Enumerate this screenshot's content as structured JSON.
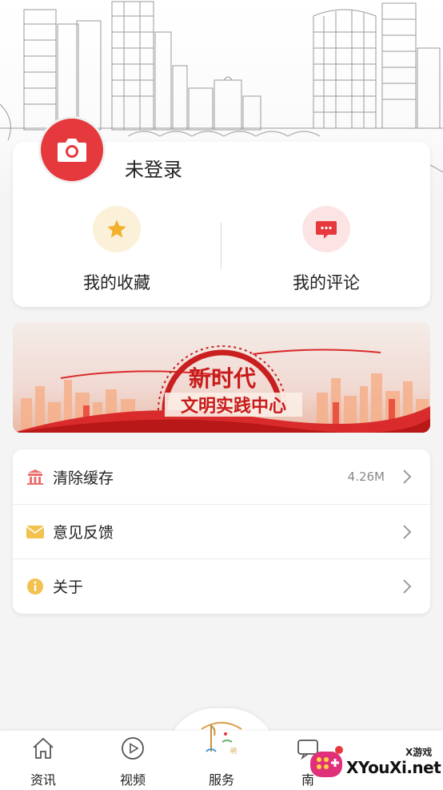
{
  "profile": {
    "login_status": "未登录",
    "avatar_icon": "camera-icon",
    "actions": [
      {
        "label": "我的收藏",
        "icon": "star-icon"
      },
      {
        "label": "我的评论",
        "icon": "chat-bubble-icon"
      }
    ]
  },
  "banner": {
    "title_line1": "新时代",
    "title_line2": "文明实践中心"
  },
  "settings": [
    {
      "label": "清除缓存",
      "value": "4.26M",
      "icon": "building-icon",
      "icon_color": "#e96f6f"
    },
    {
      "label": "意见反馈",
      "value": "",
      "icon": "envelope-icon",
      "icon_color": "#f2c14e"
    },
    {
      "label": "关于",
      "value": "",
      "icon": "info-icon",
      "icon_color": "#f2c14e"
    }
  ],
  "bottom_nav": [
    {
      "label": "资讯",
      "icon": "home-icon"
    },
    {
      "label": "视频",
      "icon": "play-circle-icon"
    },
    {
      "label": "服务",
      "icon": "service-emblem-icon"
    },
    {
      "label": "南",
      "icon": "chat-icon"
    }
  ],
  "watermark": {
    "small_text": "X游戏",
    "main_text": "XYouXi.net"
  },
  "colors": {
    "accent_red": "#e5393d",
    "star_yellow": "#f2b02c",
    "background": "#f4f4f4"
  }
}
